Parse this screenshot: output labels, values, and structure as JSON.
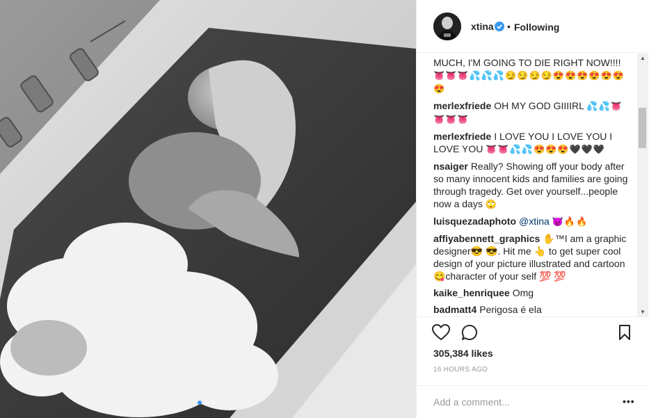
{
  "post": {
    "username": "xtina",
    "separator": "•",
    "follow_label": "Following",
    "likes": "305,384 likes",
    "timestamp": "16 HOURS AGO",
    "comment_placeholder": "Add a comment...",
    "carousel": {
      "count": 3,
      "active_index": 0
    }
  },
  "comments": [
    {
      "user": "",
      "text": "MUCH, I'M GOING TO DIE RIGHT NOW!!!!",
      "emoji": "👅👅👅💦💦💦😏😏😏😏😍😍😍😍😍😍😍"
    },
    {
      "user": "merlexfriede",
      "text": "OH MY GOD GIIIIRL",
      "emoji": "💦💦👅👅👅👅"
    },
    {
      "user": "merlexfriede",
      "text": "I LOVE YOU I LOVE YOU I LOVE YOU",
      "emoji": "👅👅💦💦😍😍😍🖤🖤🖤"
    },
    {
      "user": "nsaiger",
      "text": "Really? Showing off your body after so many innocent kids and families are going through tragedy. Get over yourself...people now a days",
      "emoji": "🙄"
    },
    {
      "user": "luisquezadaphoto",
      "mention": "@xtina",
      "text": "",
      "emoji": "😈🔥🔥"
    },
    {
      "user": "affiyabennett_graphics",
      "text": "✋™I am a graphic designer😎 😎. Hit me 👆 to get super cool design of your picture illustrated and cartoon 😋character of your self 💯 💯",
      "emoji": ""
    },
    {
      "user": "kaike_henriquee",
      "text": "Omg",
      "emoji": ""
    },
    {
      "user": "badmatt4",
      "text": "Perigosa é ela",
      "emoji": ""
    }
  ],
  "colors": {
    "accent": "#3897f0",
    "border": "#efefef",
    "text": "#262626",
    "muted": "#999999"
  },
  "icons": [
    "verified-icon",
    "heart-icon",
    "comment-icon",
    "bookmark-icon",
    "more-icon"
  ]
}
